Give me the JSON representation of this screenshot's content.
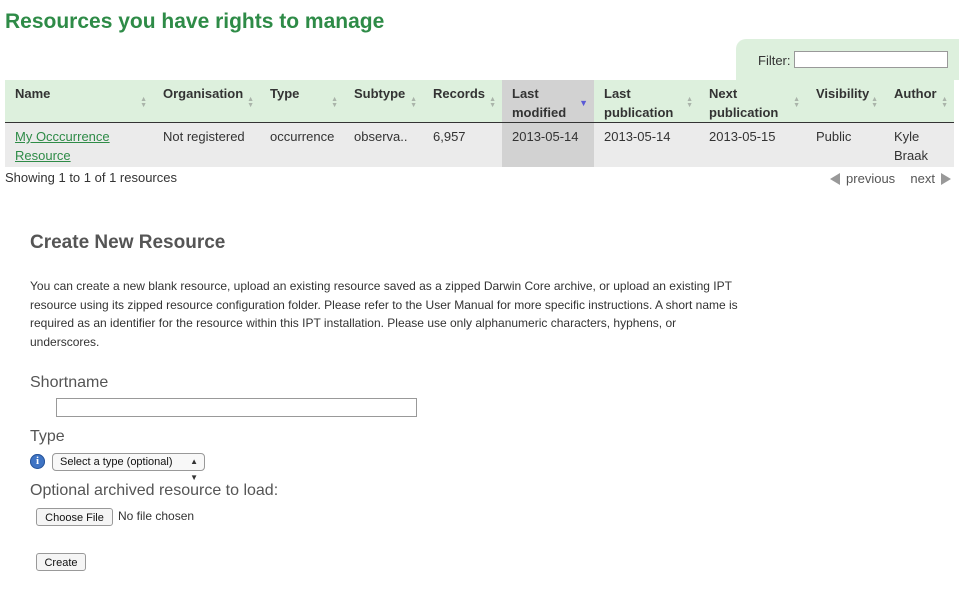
{
  "page": {
    "title": "Resources you have rights to manage",
    "filter_label": "Filter:",
    "filter_value": ""
  },
  "table": {
    "columns": [
      {
        "line1": "Name",
        "line2": ""
      },
      {
        "line1": "Organisation",
        "line2": ""
      },
      {
        "line1": "Type",
        "line2": ""
      },
      {
        "line1": "Subtype",
        "line2": ""
      },
      {
        "line1": "Records",
        "line2": ""
      },
      {
        "line1": "Last",
        "line2": "modified"
      },
      {
        "line1": "Last",
        "line2": "publication"
      },
      {
        "line1": "Next",
        "line2": "publication"
      },
      {
        "line1": "Visibility",
        "line2": ""
      },
      {
        "line1": "Author",
        "line2": ""
      }
    ],
    "sorted_column": "Last modified",
    "rows": [
      {
        "name_line1": "My Occcurrence",
        "name_line2": "Resource",
        "organisation": "Not registered",
        "type": "occurrence",
        "subtype": "observa..",
        "records": "6,957",
        "last_modified": "2013-05-14",
        "last_publication": "2013-05-14",
        "next_publication": "2013-05-15",
        "visibility": "Public",
        "author_line1": "Kyle",
        "author_line2": "Braak"
      }
    ],
    "showing": "Showing 1 to 1 of 1 resources",
    "pager": {
      "previous": "previous",
      "next": "next"
    }
  },
  "create": {
    "title": "Create New Resource",
    "intro": "You can create a new blank resource, upload an existing resource saved as a zipped Darwin Core archive, or upload an existing IPT resource using its zipped resource configuration folder. Please refer to the User Manual for more specific instructions. A short name is required as an identifier for the resource within this IPT installation. Please use only alphanumeric characters, hyphens, or underscores.",
    "shortname_label": "Shortname",
    "shortname_value": "",
    "type_label": "Type",
    "type_selected": "Select a type (optional)",
    "archive_label": "Optional archived resource to load:",
    "choose_file": "Choose File",
    "no_file": "No file chosen",
    "create_button": "Create"
  },
  "colors": {
    "title_green": "#2e8b47",
    "header_bg": "#ddf0dd",
    "sorted_bg": "#d2d2d2",
    "row_bg": "#ebebeb"
  },
  "icons": {
    "info": "info-icon",
    "sort": "sort-arrows-icon",
    "previous": "arrow-left-icon",
    "next": "arrow-right-icon"
  }
}
